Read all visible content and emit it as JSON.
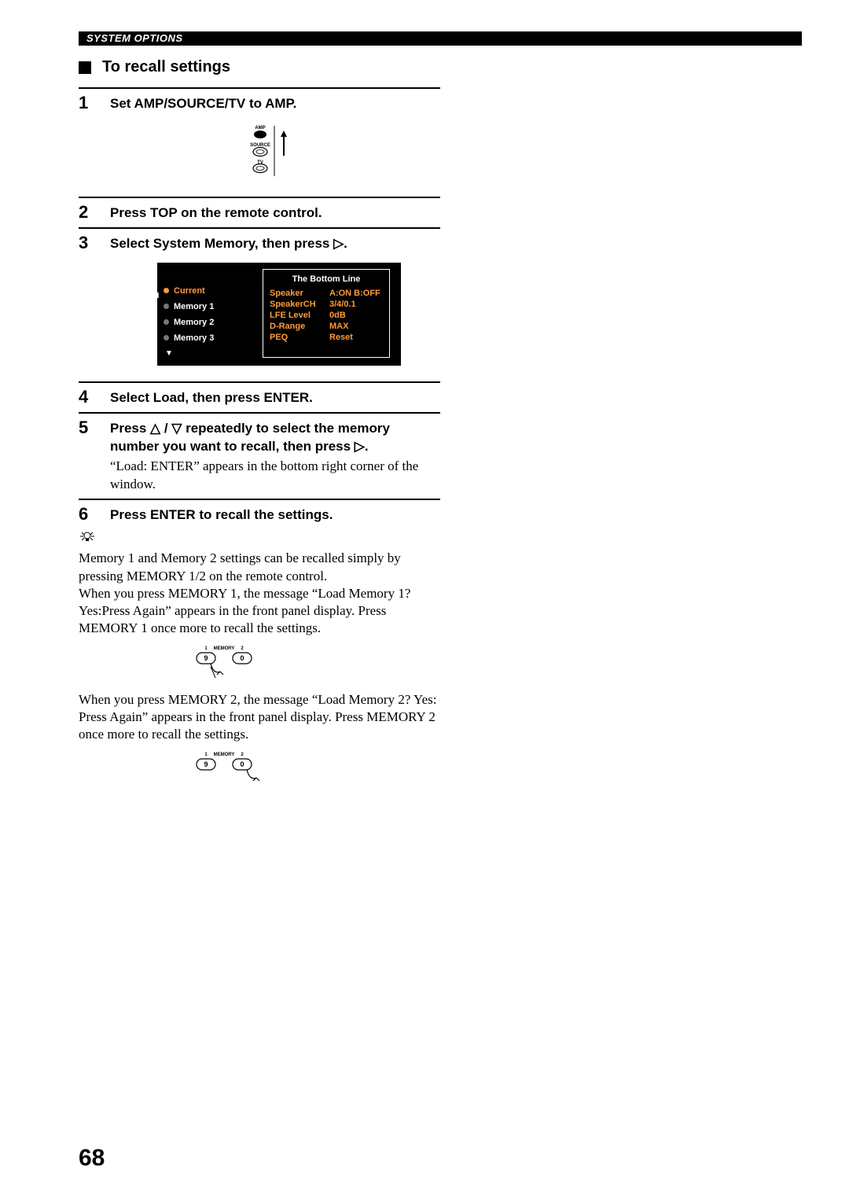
{
  "header": "SYSTEM OPTIONS",
  "section_title": "To recall settings",
  "steps": {
    "s1": {
      "num": "1",
      "bold": "Set AMP/SOURCE/TV to AMP."
    },
    "s2": {
      "num": "2",
      "bold": "Press TOP on the remote control."
    },
    "s3": {
      "num": "3",
      "bold_a": "Select System Memory, then press ",
      "bold_b": "."
    },
    "s4": {
      "num": "4",
      "bold": "Select Load, then press ENTER."
    },
    "s5": {
      "num": "5",
      "bold_a": "Press ",
      "bold_b": " / ",
      "bold_c": " repeatedly to select the memory number you want to recall, then press ",
      "bold_d": ".",
      "body": "“Load: ENTER” appears in the bottom right corner of the window."
    },
    "s6": {
      "num": "6",
      "bold": "Press ENTER to recall the settings."
    }
  },
  "switch": {
    "amp": "AMP",
    "source": "SOURCE",
    "tv": "TV"
  },
  "osd": {
    "title": "The Bottom Line",
    "menu": {
      "current": "Current",
      "m1": "Memory 1",
      "m2": "Memory 2",
      "m3": "Memory 3"
    },
    "rows": {
      "speaker_k": "Speaker",
      "speaker_v": "A:ON B:OFF",
      "speakerch_k": "SpeakerCH",
      "speakerch_v": "3/4/0.1",
      "lfe_k": "LFE Level",
      "lfe_v": "0dB",
      "drange_k": "D-Range",
      "drange_v": "MAX",
      "peq_k": "PEQ",
      "peq_v": "Reset"
    }
  },
  "tip": {
    "p1": "Memory 1 and Memory 2 settings can be recalled simply by pressing MEMORY 1/2 on the remote control.",
    "p2": "When you press MEMORY 1, the message “Load Memory 1? Yes:Press Again” appears in the front panel display. Press MEMORY 1 once more to recall the settings.",
    "p3": "When you press MEMORY 2, the message “Load Memory 2? Yes: Press Again” appears in the front panel display. Press MEMORY 2 once more to recall the settings."
  },
  "memory_label": {
    "left": "1",
    "mid": "MEMORY",
    "right": "2",
    "btn_left": "9",
    "btn_right": "0"
  },
  "page": "68"
}
